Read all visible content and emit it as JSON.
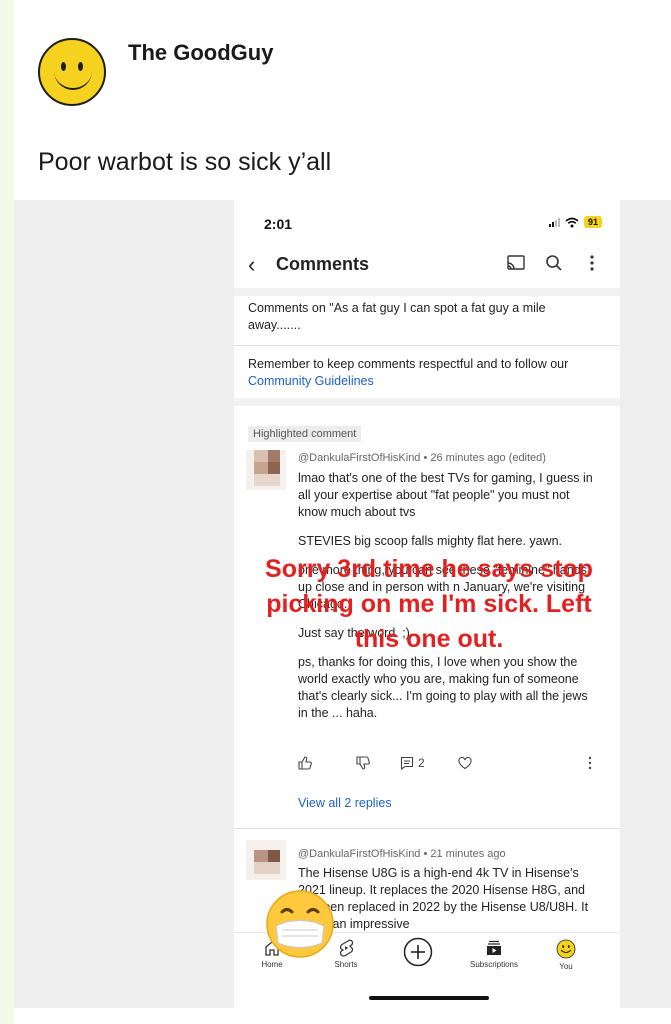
{
  "post": {
    "author": "The GoodGuy",
    "text": "Poor warbot is so sick y’all"
  },
  "screenshot": {
    "status_time": "2:01",
    "battery": "91",
    "header_title": "Comments",
    "comments_on": "Comments on \"As a fat guy I can spot a fat guy a mile away.......",
    "remember_text": "Remember to keep comments respectful and to follow our ",
    "guidelines_link": "Community Guidelines",
    "highlighted_label": "Highlighted comment",
    "comment1": {
      "meta": "@DankulaFirstOfHisKind • 26 minutes ago (edited)",
      "para1": "lmao that's one of the best TVs for gaming, I guess in all your expertise about \"fat people\" you must not know much about tvs",
      "para2": "STEVIES big scoop falls mighty flat here. yawn.",
      "para3": "one more thing, you can see these \"feminine\" hands up close and in person with n January, we're visiting Chicago.",
      "para4": "Just say the word. ;)",
      "para5": "ps, thanks for doing this, I love when you show the world exactly who you are, making fun of someone that's clearly sick... I'm going to play with all the jews in the ... haha.",
      "reply_count": "2"
    },
    "overlay_text": "Sorry 3rd time he says stop picking on me I'm sick. Left this one out.",
    "view_replies": "View all 2 replies",
    "comment2": {
      "meta": "@DankulaFirstOfHisKind • 21 minutes ago",
      "body": "The Hisense U8G is a high-end 4k TV in Hisense's 2021 lineup. It replaces the 2020 Hisense H8G, and it's been replaced in 2022 by the Hisense U8/U8H. It offers an impressive"
    },
    "nav": {
      "home": "Home",
      "shorts": "Shorts",
      "subscriptions": "Subscriptions",
      "you": "You"
    }
  },
  "colors": {
    "overlay_red": "#e32121",
    "link_blue": "#1e61c4",
    "smiley_yellow": "#f4d21f"
  }
}
